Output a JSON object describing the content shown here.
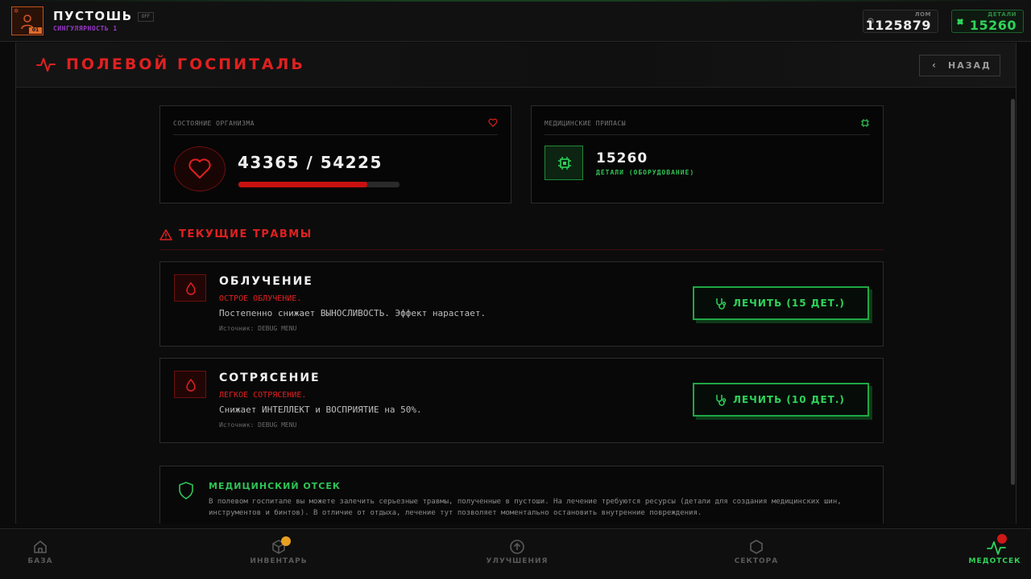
{
  "player": {
    "name": "ПУСТОШЬ",
    "tag": "OFF",
    "subtitle": "СИНГУЛЯРНОСТЬ 1",
    "level_badge": "01"
  },
  "resources": {
    "scrap": {
      "label": "ЛОМ",
      "value": "1125879"
    },
    "parts": {
      "label": "ДЕТАЛИ",
      "value": "15260"
    }
  },
  "page": {
    "title": "ПОЛЕВОЙ ГОСПИТАЛЬ",
    "back_label": "НАЗАД"
  },
  "health": {
    "label": "СОСТОЯНИЕ ОРГАНИЗМА",
    "current": 43365,
    "max": 54225,
    "text": "43365 / 54225",
    "fill_fraction": 0.8
  },
  "supplies": {
    "label": "МЕДИЦИНСКИЕ ПРИПАСЫ",
    "value": "15260",
    "sub": "ДЕТАЛИ (ОБОРУДОВАНИЕ)"
  },
  "injuries": {
    "title": "ТЕКУЩИЕ ТРАВМЫ",
    "items": [
      {
        "name": "ОБЛУЧЕНИЕ",
        "severity": "ОСТРОЕ ОБЛУЧЕНИЕ.",
        "description": "Постепенно снижает ВЫНОСЛИВОСТЬ. Эффект нарастает.",
        "source": "Источник: DEBUG MENU",
        "button": "ЛЕЧИТЬ (15 ДЕТ.)"
      },
      {
        "name": "СОТРЯСЕНИЕ",
        "severity": "ЛЕГКОЕ СОТРЯСЕНИЕ.",
        "description": "Снижает ИНТЕЛЛЕКТ и ВОСПРИЯТИЕ на 50%.",
        "source": "Источник: DEBUG MENU",
        "button": "ЛЕЧИТЬ (10 ДЕТ.)"
      }
    ]
  },
  "info": {
    "title": "МЕДИЦИНСКИЙ ОТСЕК",
    "text": "В полевом госпитале вы можете залечить серьезные травмы, полученные в пустоши. На лечение требуются ресурсы (детали для создания медицинских шин, инструментов и бинтов). В отличие от отдыха, лечение тут позволяет моментально остановить внутренние повреждения."
  },
  "nav": {
    "items": [
      {
        "label": "БАЗА",
        "icon": "home-icon"
      },
      {
        "label": "ИНВЕНТАРЬ",
        "icon": "box-icon"
      },
      {
        "label": "УЛУЧШЕНИЯ",
        "icon": "upgrade-arrow-icon"
      },
      {
        "label": "СЕКТОРА",
        "icon": "hexagon-icon"
      },
      {
        "label": "МЕДОТСЕК",
        "icon": "pulse-icon"
      }
    ],
    "active": "МЕДОТСЕК"
  },
  "colors": {
    "accent_red": "#e02020",
    "accent_green": "#2fd35a",
    "background": "#0b0b0b",
    "badge_orange": "#e8a020",
    "badge_red": "#d01818"
  }
}
